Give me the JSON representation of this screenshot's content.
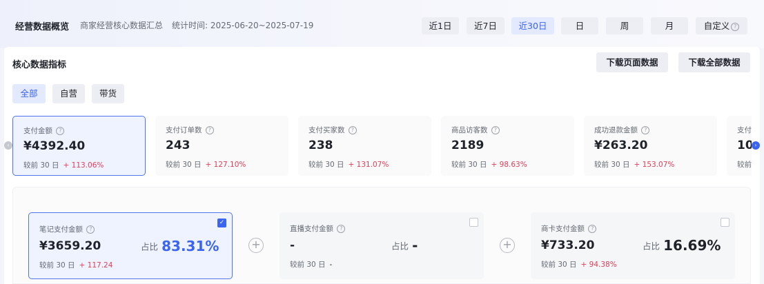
{
  "header": {
    "title": "经营数据概览",
    "subtitle": "商家经营核心数据汇总",
    "stat_time_label": "统计时间:",
    "stat_time_range": "2025-06-20~2025-07-19",
    "ranges": [
      {
        "label": "近1日",
        "active": false
      },
      {
        "label": "近7日",
        "active": false
      },
      {
        "label": "近30日",
        "active": true
      },
      {
        "label": "日",
        "active": false
      },
      {
        "label": "周",
        "active": false
      },
      {
        "label": "月",
        "active": false
      },
      {
        "label": "自定义",
        "active": false
      }
    ]
  },
  "core": {
    "title": "核心数据指标",
    "download_page": "下载页面数据",
    "download_all": "下载全部数据",
    "filters": [
      {
        "label": "全部",
        "active": true
      },
      {
        "label": "自营",
        "active": false
      },
      {
        "label": "带货",
        "active": false
      }
    ],
    "compare_label": "较前 30 日",
    "metrics": [
      {
        "label": "支付金额",
        "value": "¥4392.40",
        "change": "+ 113.06%",
        "active": true
      },
      {
        "label": "支付订单数",
        "value": "243",
        "change": "+ 127.10%",
        "active": false
      },
      {
        "label": "支付买家数",
        "value": "238",
        "change": "+ 131.07%",
        "active": false
      },
      {
        "label": "商品访客数",
        "value": "2189",
        "change": "+ 98.63%",
        "active": false
      },
      {
        "label": "成功退款金额",
        "value": "¥263.20",
        "change": "+ 153.07%",
        "active": false
      },
      {
        "label": "支付",
        "value": "10",
        "change": "",
        "active": false
      }
    ]
  },
  "breakdown": {
    "share_label": "占比",
    "compare_label": "较前 30 日",
    "cards": [
      {
        "label": "笔记支付金额",
        "value": "¥3659.20",
        "share": "83.31%",
        "change": "+ 117.24",
        "checked": true
      },
      {
        "label": "直播支付金额",
        "value": "-",
        "share": "-",
        "change": "-",
        "checked": false
      },
      {
        "label": "商卡支付金额",
        "value": "¥733.20",
        "share": "16.69%",
        "change": "+ 94.38%",
        "checked": false
      }
    ]
  },
  "icons": {
    "info": "question-circle-icon",
    "plus": "plus-circle-icon",
    "check": "checkmark-icon",
    "nav_left": "chevron-left-icon",
    "nav_right": "chevron-right-icon"
  },
  "colors": {
    "accent": "#3b64f0",
    "increase": "#e23c55",
    "active_bg": "#eef3ff"
  }
}
